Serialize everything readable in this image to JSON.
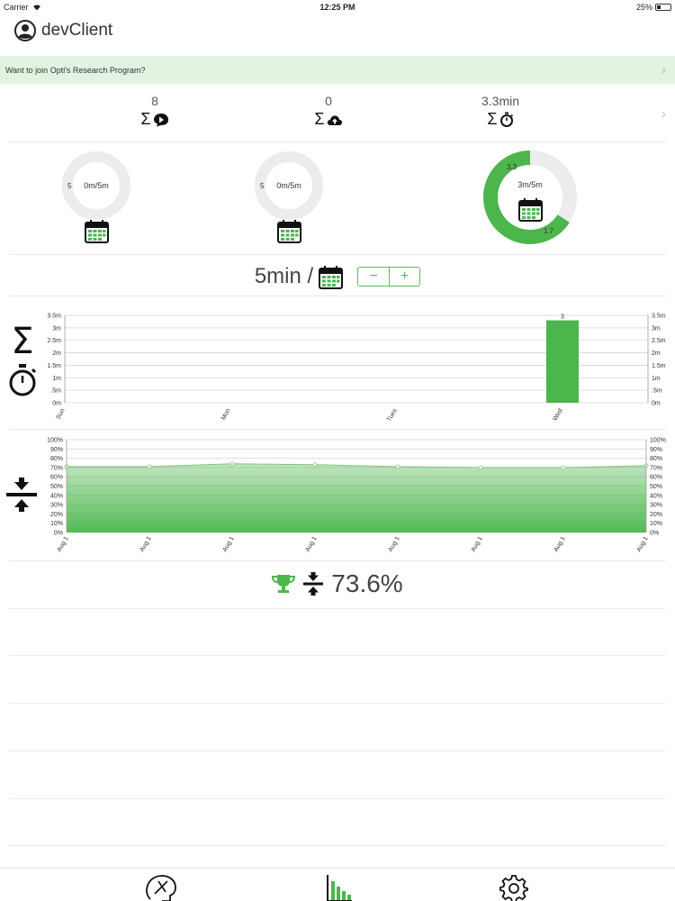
{
  "status_bar": {
    "carrier": "Carrier",
    "time": "12:25 PM",
    "battery": "25%",
    "battery_level": 0.25
  },
  "header": {
    "title": "devClient",
    "icon": "user-circle-icon"
  },
  "banner": {
    "text": "Want to join Opti's Research Program?",
    "background": "#e3f3e1"
  },
  "totals": [
    {
      "value": "8",
      "icon": "sum-play-icon"
    },
    {
      "value": "0",
      "icon": "sum-cloud-upload-icon"
    },
    {
      "value": "3.3min",
      "icon": "sum-stopwatch-icon"
    }
  ],
  "rings": [
    {
      "center": "0m/5m",
      "left_label": "5",
      "progress": 0,
      "icon": "calendar-icon"
    },
    {
      "center": "0m/5m",
      "left_label": "5",
      "progress": 0,
      "icon": "calendar-icon"
    },
    {
      "center": "3m/5m",
      "top_label": "3.3",
      "bottom_label": "1.7",
      "progress": 0.66,
      "icon": "calendar-icon"
    }
  ],
  "goal": {
    "text": "5min /",
    "minus": "−",
    "plus": "+"
  },
  "accent_color": "#4cb54c",
  "chart_data": [
    {
      "type": "bar",
      "categories": [
        "Sun",
        "Mon",
        "Tues",
        "Wed"
      ],
      "values": [
        0,
        0,
        0,
        3.3
      ],
      "value_labels": [
        "",
        "",
        "",
        "3"
      ],
      "yticks": [
        "0m",
        ".5m",
        "1m",
        "1.5m",
        "2m",
        "2.5m",
        "3m",
        "3.5m"
      ],
      "ylim": [
        0,
        3.5
      ],
      "grid": true
    },
    {
      "type": "area",
      "x": [
        "Aug 1",
        "Aug 1",
        "Aug 1",
        "Aug 1",
        "Aug 1",
        "Aug 1",
        "Aug 1",
        "Aug 1"
      ],
      "values": [
        71,
        71,
        74,
        73,
        71,
        70,
        70,
        72
      ],
      "yticks": [
        "0%",
        "10%",
        "20%",
        "30%",
        "40%",
        "50%",
        "60%",
        "70%",
        "80%",
        "90%",
        "100%"
      ],
      "ylim": [
        0,
        100
      ],
      "grid": true
    }
  ],
  "score": {
    "value": "73.6%",
    "icons": [
      "trophy-icon",
      "compress-icon"
    ]
  },
  "tabs": [
    {
      "name": "tab-brain",
      "icon": "brain-icon"
    },
    {
      "name": "tab-stats",
      "icon": "bar-chart-icon"
    },
    {
      "name": "tab-settings",
      "icon": "gear-icon"
    }
  ]
}
